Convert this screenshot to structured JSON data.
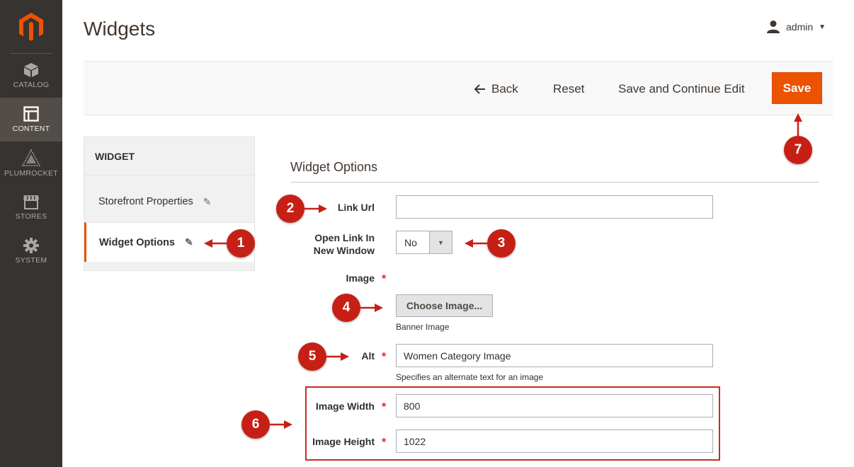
{
  "nav": {
    "items": [
      {
        "label": "CATALOG",
        "icon": "box-icon"
      },
      {
        "label": "CONTENT",
        "icon": "layout-icon"
      },
      {
        "label": "PLUMROCKET",
        "icon": "plumrocket-icon"
      },
      {
        "label": "STORES",
        "icon": "store-icon"
      },
      {
        "label": "SYSTEM",
        "icon": "gear-icon"
      }
    ],
    "active": "CONTENT"
  },
  "header": {
    "title": "Widgets",
    "user": "admin"
  },
  "toolbar": {
    "back_label": "Back",
    "reset_label": "Reset",
    "save_continue_label": "Save and Continue Edit",
    "save_label": "Save"
  },
  "tabs": {
    "heading": "WIDGET",
    "items": [
      {
        "label": "Storefront Properties"
      },
      {
        "label": "Widget Options"
      }
    ]
  },
  "form": {
    "section_title": "Widget Options",
    "link_url": {
      "label": "Link Url",
      "value": ""
    },
    "open_new_window": {
      "label_line1": "Open Link In",
      "label_line2": "New Window",
      "value": "No"
    },
    "image": {
      "label": "Image",
      "button_label": "Choose Image...",
      "note": "Banner Image"
    },
    "alt": {
      "label": "Alt",
      "value": "Women Category Image",
      "note": "Specifies an alternate text for an image"
    },
    "image_width": {
      "label": "Image Width",
      "value": "800"
    },
    "image_height": {
      "label": "Image Height",
      "value": "1022"
    },
    "required_mark": "*"
  },
  "callouts": [
    "1",
    "2",
    "3",
    "4",
    "5",
    "6",
    "7"
  ],
  "colors": {
    "accent": "#eb5202",
    "callout": "#c62016",
    "nav_bg": "#373330"
  }
}
